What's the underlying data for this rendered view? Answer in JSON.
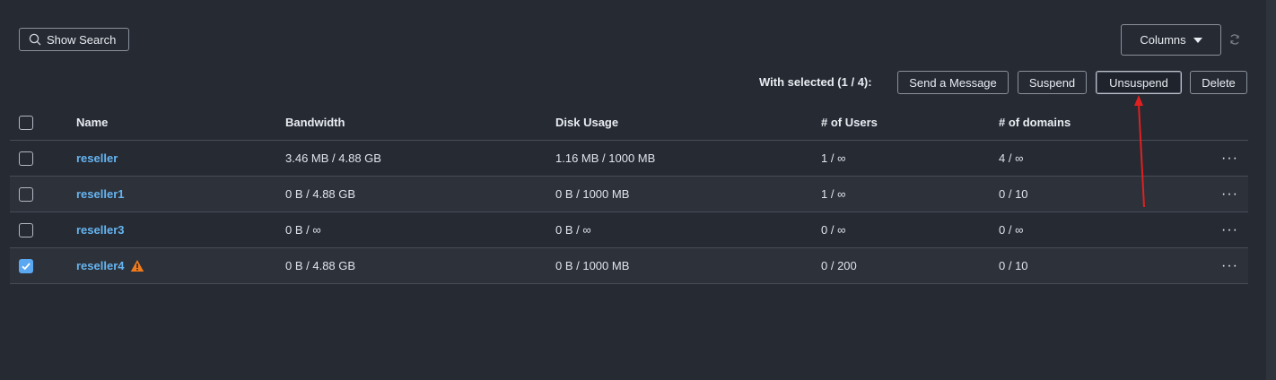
{
  "toolbar": {
    "show_search_label": "Show Search",
    "columns_label": "Columns"
  },
  "bulk": {
    "with_selected_label": "With selected (1 / 4):",
    "send_message_label": "Send a Message",
    "suspend_label": "Suspend",
    "unsuspend_label": "Unsuspend",
    "delete_label": "Delete"
  },
  "table": {
    "headers": {
      "name": "Name",
      "bandwidth": "Bandwidth",
      "disk": "Disk Usage",
      "users": "# of Users",
      "domains": "# of domains"
    },
    "rows": [
      {
        "name": "reseller",
        "bandwidth": "3.46 MB / 4.88 GB",
        "disk": "1.16 MB / 1000 MB",
        "users": "1 / ∞",
        "domains": "4 / ∞",
        "checked": false,
        "warning": false
      },
      {
        "name": "reseller1",
        "bandwidth": "0 B / 4.88 GB",
        "disk": "0 B / 1000 MB",
        "users": "1 / ∞",
        "domains": "0 / 10",
        "checked": false,
        "warning": false
      },
      {
        "name": "reseller3",
        "bandwidth": "0 B / ∞",
        "disk": "0 B / ∞",
        "users": "0 / ∞",
        "domains": "0 / ∞",
        "checked": false,
        "warning": false
      },
      {
        "name": "reseller4",
        "bandwidth": "0 B / 4.88 GB",
        "disk": "0 B / 1000 MB",
        "users": "0 / 200",
        "domains": "0 / 10",
        "checked": true,
        "warning": true
      }
    ],
    "row_menu_glyph": "···"
  },
  "colors": {
    "background": "#262a33",
    "link": "#66b5f0",
    "checkbox_checked": "#5aa8f2",
    "warning": "#f07b1d",
    "annotation_arrow": "#e02020"
  },
  "icons": {
    "search": "search-icon",
    "refresh": "refresh-icon",
    "caret": "caret-down-icon",
    "warning": "warning-icon",
    "menu": "more-horizontal-icon"
  }
}
